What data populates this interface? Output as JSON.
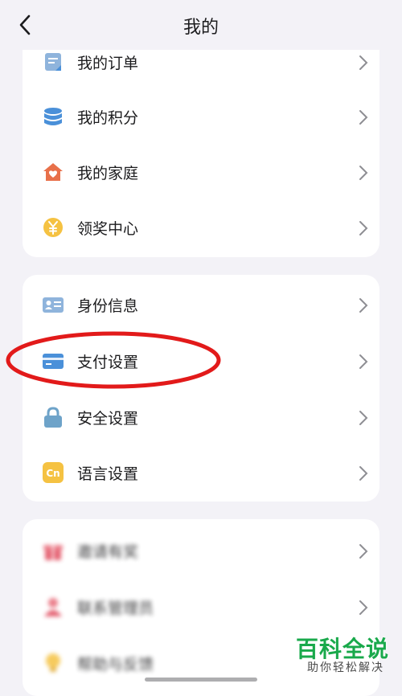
{
  "header": {
    "title": "我的"
  },
  "groups": [
    {
      "items": [
        {
          "label": "我的订单",
          "icon": "order-icon"
        },
        {
          "label": "我的积分",
          "icon": "points-icon"
        },
        {
          "label": "我的家庭",
          "icon": "home-icon"
        },
        {
          "label": "领奖中心",
          "icon": "reward-icon"
        }
      ]
    },
    {
      "items": [
        {
          "label": "身份信息",
          "icon": "id-card-icon"
        },
        {
          "label": "支付设置",
          "icon": "payment-card-icon"
        },
        {
          "label": "安全设置",
          "icon": "lock-icon"
        },
        {
          "label": "语言设置",
          "icon": "language-icon"
        }
      ]
    },
    {
      "items": [
        {
          "label": "邀请有奖",
          "icon": "gift-icon"
        },
        {
          "label": "联系管理员",
          "icon": "contact-icon"
        },
        {
          "label": "帮助与反馈",
          "icon": "bulb-icon"
        }
      ]
    }
  ],
  "watermark": {
    "title": "百科全说",
    "subtitle": "助你轻松解决"
  },
  "colors": {
    "background": "#f3f2f7",
    "card": "#ffffff",
    "icon_blue": "#4a90d9",
    "icon_orange": "#e8704a",
    "icon_yellow": "#f5c242",
    "annotation_red": "#e21a1a",
    "watermark_green": "#19a94b"
  }
}
